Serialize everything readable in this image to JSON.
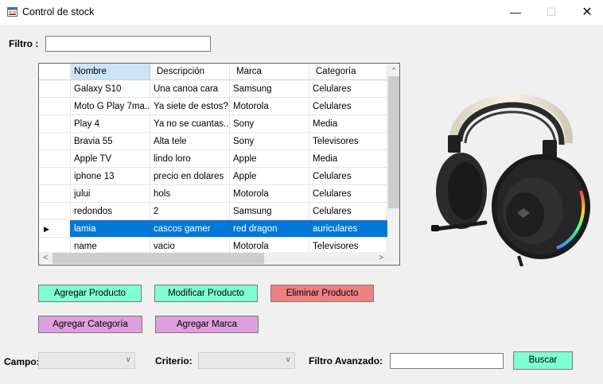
{
  "window": {
    "title": "Control de stock",
    "minimize_glyph": "—",
    "maximize_glyph": "☐",
    "close_glyph": "✕"
  },
  "filter": {
    "label": "Filtro :",
    "value": ""
  },
  "grid": {
    "columns": [
      "Nombre",
      "Descripción",
      "Marca",
      "Categoría"
    ],
    "rows": [
      {
        "nombre": "Galaxy S10",
        "descripcion": "Una canoa cara",
        "marca": "Samsung",
        "categoria": "Celulares"
      },
      {
        "nombre": "Moto G Play 7ma...",
        "descripcion": "Ya siete de estos?",
        "marca": "Motorola",
        "categoria": "Celulares"
      },
      {
        "nombre": "Play 4",
        "descripcion": "Ya no se cuantas...",
        "marca": "Sony",
        "categoria": "Media"
      },
      {
        "nombre": "Bravia 55",
        "descripcion": "Alta tele",
        "marca": "Sony",
        "categoria": "Televisores"
      },
      {
        "nombre": "Apple TV",
        "descripcion": "lindo loro",
        "marca": "Apple",
        "categoria": "Media"
      },
      {
        "nombre": "iphone 13",
        "descripcion": "precio en dolares",
        "marca": "Apple",
        "categoria": "Celulares"
      },
      {
        "nombre": "jului",
        "descripcion": "hols",
        "marca": "Motorola",
        "categoria": "Celulares"
      },
      {
        "nombre": "redondos",
        "descripcion": "2",
        "marca": "Samsung",
        "categoria": "Celulares"
      },
      {
        "nombre": "lamia",
        "descripcion": "cascos gamer",
        "marca": "red dragon",
        "categoria": "auriculares",
        "selected": true
      },
      {
        "nombre": "name",
        "descripcion": "vacio",
        "marca": "Motorola",
        "categoria": "Televisores"
      }
    ],
    "selected_indicator": "▶",
    "scroll_up_glyph": "^",
    "scroll_left_glyph": "<",
    "scroll_right_glyph": ">"
  },
  "buttons": {
    "agregar_producto": "Agregar Producto",
    "modificar_producto": "Modificar Producto",
    "eliminar_producto": "Eliminar Producto",
    "agregar_categoria": "Agregar Categoría",
    "agregar_marca": "Agregar Marca",
    "buscar": "Buscar"
  },
  "advanced": {
    "campo_label": "Campo:",
    "campo_value": "",
    "criterio_label": "Criterio:",
    "criterio_value": "",
    "filtro_avanzado_label": "Filtro Avanzado:",
    "filtro_avanzado_value": ""
  },
  "colors": {
    "green_button": "#7fffd4",
    "red_button": "#f08080",
    "violet_button": "#dda0dd",
    "selection": "#0078d7",
    "header_selected": "#cce4f7"
  },
  "icons": {
    "app": "form-icon",
    "product_image": "headphones-image",
    "combo_arrow": "chevron-down-icon"
  }
}
